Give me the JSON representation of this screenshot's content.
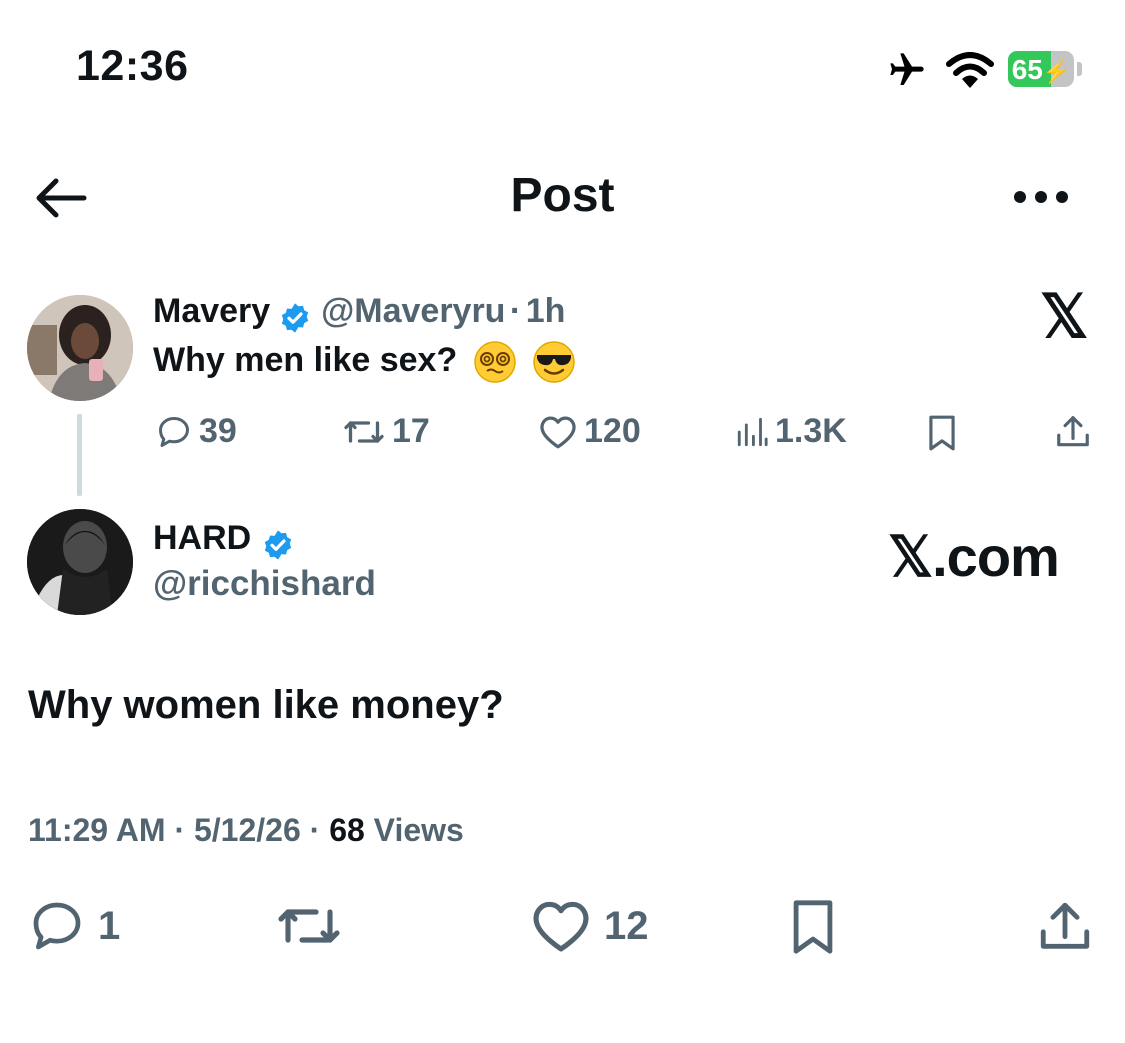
{
  "status_bar": {
    "time": "12:36",
    "battery": "65",
    "battery_level_percent": 65,
    "icons": [
      "airplane-icon",
      "wifi-icon",
      "battery-charging-icon"
    ]
  },
  "nav": {
    "title": "Post",
    "back_icon": "arrow-left-icon",
    "more_icon": "more-icon"
  },
  "quoted_post": {
    "name": "Mavery",
    "handle": "@Maveryru",
    "separator": "·",
    "time": "1h",
    "text": "Why men like sex?",
    "emojis": [
      "face-with-spiral-eyes",
      "smiling-face-with-sunglasses"
    ],
    "replies": "39",
    "reposts": "17",
    "likes": "120",
    "views": "1.3K",
    "source_mark": "𝕏"
  },
  "post": {
    "name": "HARD",
    "handle": "@ricchishard",
    "source_mark": "𝕏.com",
    "text": "Why women like money?",
    "time": "11:29 AM",
    "sep1": "·",
    "date": "5/12/26",
    "sep2": "·",
    "views_count": "68",
    "views_label": "Views",
    "actions": {
      "replies": "1",
      "likes": "12"
    }
  },
  "colors": {
    "text": "#0f1419",
    "secondary": "#536471",
    "verified": "#1d9bf0",
    "battery": "#34c759"
  }
}
